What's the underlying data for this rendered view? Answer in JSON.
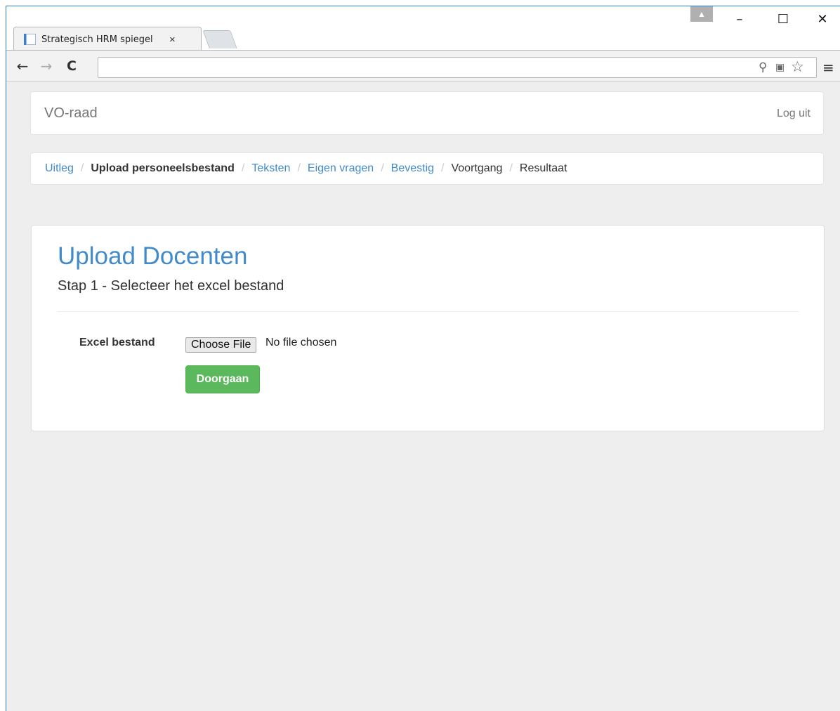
{
  "browser": {
    "tab_title": "Strategisch HRM spiegel",
    "tab_close": "×",
    "window_controls": {
      "minimize": "–",
      "maximize": "☐",
      "close": "✕"
    },
    "nav": {
      "back": "←",
      "forward": "→",
      "reload": "C"
    },
    "address_value": "",
    "omnibox_icons": [
      "zoom-icon",
      "translate-icon",
      "bookmark-star-icon"
    ],
    "menu": "≡"
  },
  "navbar": {
    "brand": "VO-raad",
    "logout": "Log uit"
  },
  "breadcrumb": {
    "items": [
      {
        "label": "Uitleg",
        "state": "link"
      },
      {
        "label": "Upload personeelsbestand",
        "state": "active"
      },
      {
        "label": "Teksten",
        "state": "link"
      },
      {
        "label": "Eigen vragen",
        "state": "link"
      },
      {
        "label": "Bevestig",
        "state": "link"
      },
      {
        "label": "Voortgang",
        "state": "plain"
      },
      {
        "label": "Resultaat",
        "state": "plain"
      }
    ],
    "separator": "/"
  },
  "panel": {
    "title": "Upload Docenten",
    "subtitle": "Stap 1 - Selecteer het excel bestand",
    "field_label": "Excel bestand",
    "file_button": "Choose File",
    "file_status": "No file chosen",
    "submit_label": "Doorgaan"
  },
  "colors": {
    "link": "#428bca",
    "success": "#5cb85c",
    "page_bg": "#eeeeee"
  }
}
